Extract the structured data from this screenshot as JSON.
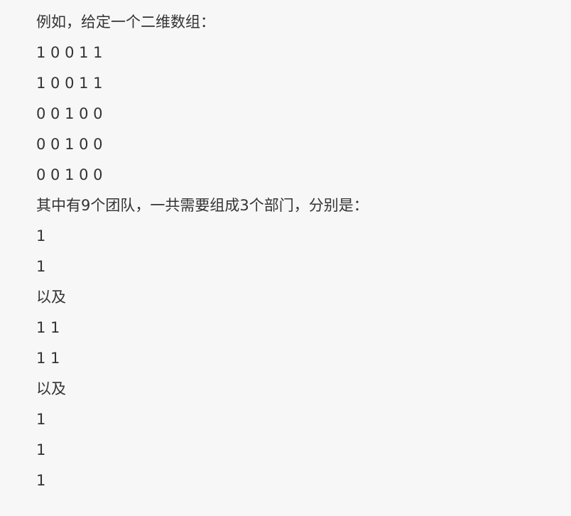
{
  "document": {
    "lines": [
      "例如，给定一个二维数组：",
      "1 0 0 1 1",
      "1 0 0 1 1",
      "0 0 1 0 0",
      "0 0 1 0 0",
      "0 0 1 0 0",
      "其中有9个团队，一共需要组成3个部门，分别是：",
      "1",
      "1",
      "以及",
      "1 1",
      "1 1",
      "以及",
      "1",
      "1",
      "1"
    ]
  }
}
